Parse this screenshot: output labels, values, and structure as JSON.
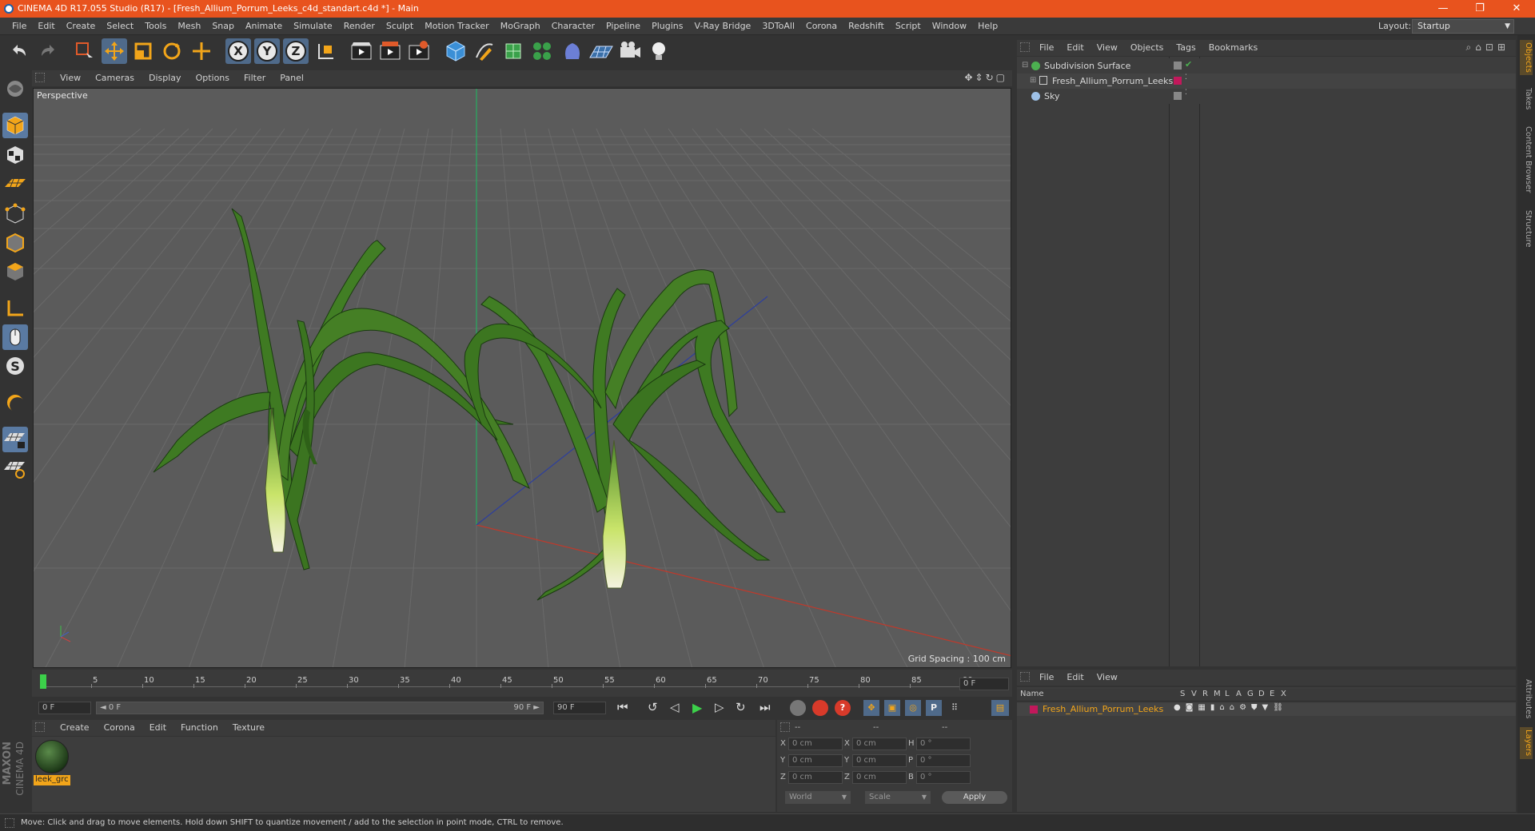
{
  "app": {
    "title": "CINEMA 4D R17.055 Studio (R17) - [Fresh_Allium_Porrum_Leeks_c4d_standart.c4d *] - Main",
    "window_controls": {
      "minimize": "—",
      "restore": "❐",
      "close": "✕"
    }
  },
  "menu": [
    "File",
    "Edit",
    "Create",
    "Select",
    "Tools",
    "Mesh",
    "Snap",
    "Animate",
    "Simulate",
    "Render",
    "Sculpt",
    "Motion Tracker",
    "MoGraph",
    "Character",
    "Pipeline",
    "Plugins",
    "V-Ray Bridge",
    "3DToAll",
    "Corona",
    "Redshift",
    "Script",
    "Window",
    "Help"
  ],
  "layout": {
    "label": "Layout:",
    "value": "Startup"
  },
  "toolbar": {
    "icons": [
      "undo-icon",
      "redo-icon",
      "live-selection-icon",
      "move-icon",
      "scale-icon",
      "rotate-icon",
      "recent-tool-icon",
      "x-axis-lock-icon",
      "y-axis-lock-icon",
      "z-axis-lock-icon",
      "world-coordinates-icon",
      "render-view-icon",
      "render-picture-viewer-icon",
      "render-settings-icon",
      "cube-icon",
      "pen-icon",
      "subdivision-icon",
      "cloner-icon",
      "deformer-icon",
      "floor-icon",
      "camera-icon",
      "light-icon"
    ],
    "axis_labels": [
      "X",
      "Y",
      "Z"
    ]
  },
  "viewport": {
    "menu": [
      "View",
      "Cameras",
      "Display",
      "Options",
      "Filter",
      "Panel"
    ],
    "label": "Perspective",
    "grid_spacing": "Grid Spacing : 100 cm",
    "axis_colors": {
      "x": "#c0392b",
      "y": "#27ae60",
      "z": "#2c3e9e"
    }
  },
  "timeline": {
    "ticks": [
      "0",
      "5",
      "10",
      "15",
      "20",
      "25",
      "30",
      "35",
      "40",
      "45",
      "50",
      "55",
      "60",
      "65",
      "70",
      "75",
      "80",
      "85",
      "90"
    ],
    "current_frame_display": "0 F",
    "start_field": "0 F",
    "range_start": "◄ 0 F",
    "range_end": "90 F ►",
    "end_field": "90 F"
  },
  "material_manager": {
    "menu": [
      "Create",
      "Corona",
      "Edit",
      "Function",
      "Texture"
    ],
    "materials": [
      {
        "name": "leek_grc"
      }
    ]
  },
  "coordinates": {
    "headers": [
      "--",
      "--",
      "--"
    ],
    "rows": [
      {
        "a": "X",
        "pos": "0 cm",
        "b": "X",
        "size": "0 cm",
        "c": "H",
        "rot": "0 °"
      },
      {
        "a": "Y",
        "pos": "0 cm",
        "b": "Y",
        "size": "0 cm",
        "c": "P",
        "rot": "0 °"
      },
      {
        "a": "Z",
        "pos": "0 cm",
        "b": "Z",
        "size": "0 cm",
        "c": "B",
        "rot": "0 °"
      }
    ],
    "mode": "World",
    "size_mode": "Scale",
    "apply": "Apply"
  },
  "object_manager": {
    "menu": [
      "File",
      "Edit",
      "View",
      "Objects",
      "Tags",
      "Bookmarks"
    ],
    "objects": [
      {
        "name": "Subdivision Surface",
        "color": "#4caf50"
      },
      {
        "name": "Fresh_Allium_Porrum_Leeks",
        "color": "#c2185b"
      },
      {
        "name": "Sky",
        "color": "#9ec1e8"
      }
    ]
  },
  "layer_manager": {
    "menu": [
      "File",
      "Edit",
      "View"
    ],
    "columns": [
      "Name",
      "S",
      "V",
      "R",
      "M",
      "L",
      "A",
      "G",
      "D",
      "E",
      "X"
    ],
    "layers": [
      {
        "name": "Fresh_Allium_Porrum_Leeks",
        "color": "#c2185b"
      }
    ]
  },
  "right_tabs": [
    "Objects",
    "Takes",
    "Content Browser",
    "Structure",
    "Attributes",
    "Layers"
  ],
  "status": "Move: Click and drag to move elements. Hold down SHIFT to quantize movement / add to the selection in point mode, CTRL to remove.",
  "brand": {
    "line1": "MAXON",
    "line2": "CINEMA 4D"
  }
}
